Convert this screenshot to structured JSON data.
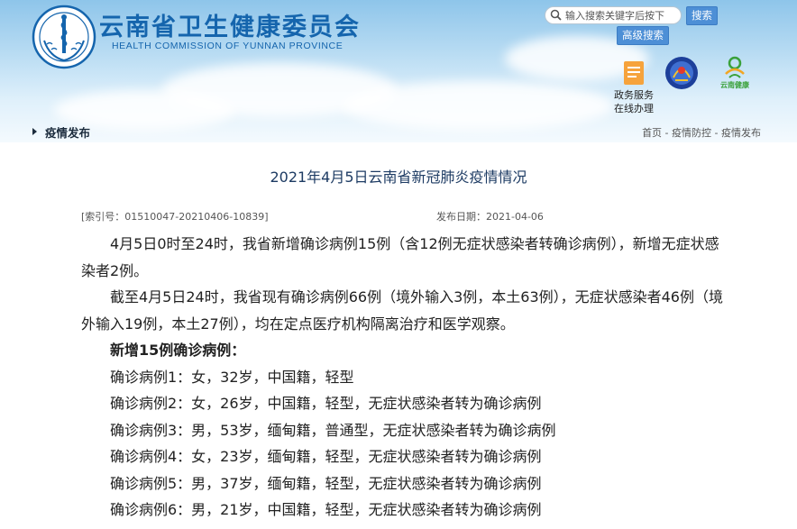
{
  "header": {
    "title": "云南省卫生健康委员会",
    "subtitle": "HEALTH COMMISSION OF YUNNAN PROVINCE",
    "search": {
      "placeholder": "输入搜索关键字后按下",
      "button": "搜索"
    },
    "advanced_search": "高级搜索",
    "gov_service_label": "政务服务在线办理",
    "health_yunnan_label": "云南健康"
  },
  "nav": {
    "current": "疫情发布",
    "breadcrumb": [
      "首页",
      "疫情防控",
      "疫情发布"
    ],
    "separator": " - "
  },
  "article": {
    "title": "2021年4月5日云南省新冠肺炎疫情情况",
    "index_label": "[索引号：01510047-20210406-10839]",
    "date_label": "发布日期：2021-04-06",
    "paragraphs": [
      "4月5日0时至24时，我省新增确诊病例15例（含12例无症状感染者转确诊病例），新增无症状感染者2例。",
      "截至4月5日24时，我省现有确诊病例66例（境外输入3例，本土63例），无症状感染者46例（境外输入19例，本土27例），均在定点医疗机构隔离治疗和医学观察。"
    ],
    "subheading": "新增15例确诊病例：",
    "cases": [
      "确诊病例1：女，32岁，中国籍，轻型",
      "确诊病例2：女，26岁，中国籍，轻型，无症状感染者转为确诊病例",
      "确诊病例3：男，53岁，缅甸籍，普通型，无症状感染者转为确诊病例",
      "确诊病例4：女，23岁，缅甸籍，轻型，无症状感染者转为确诊病例",
      "确诊病例5：男，37岁，缅甸籍，轻型，无症状感染者转为确诊病例",
      "确诊病例6：男，21岁，中国籍，轻型，无症状感染者转为确诊病例"
    ]
  },
  "colors": {
    "brand_blue": "#1565ad",
    "button_blue": "#4d8fd6",
    "title_navy": "#1d3b63"
  }
}
